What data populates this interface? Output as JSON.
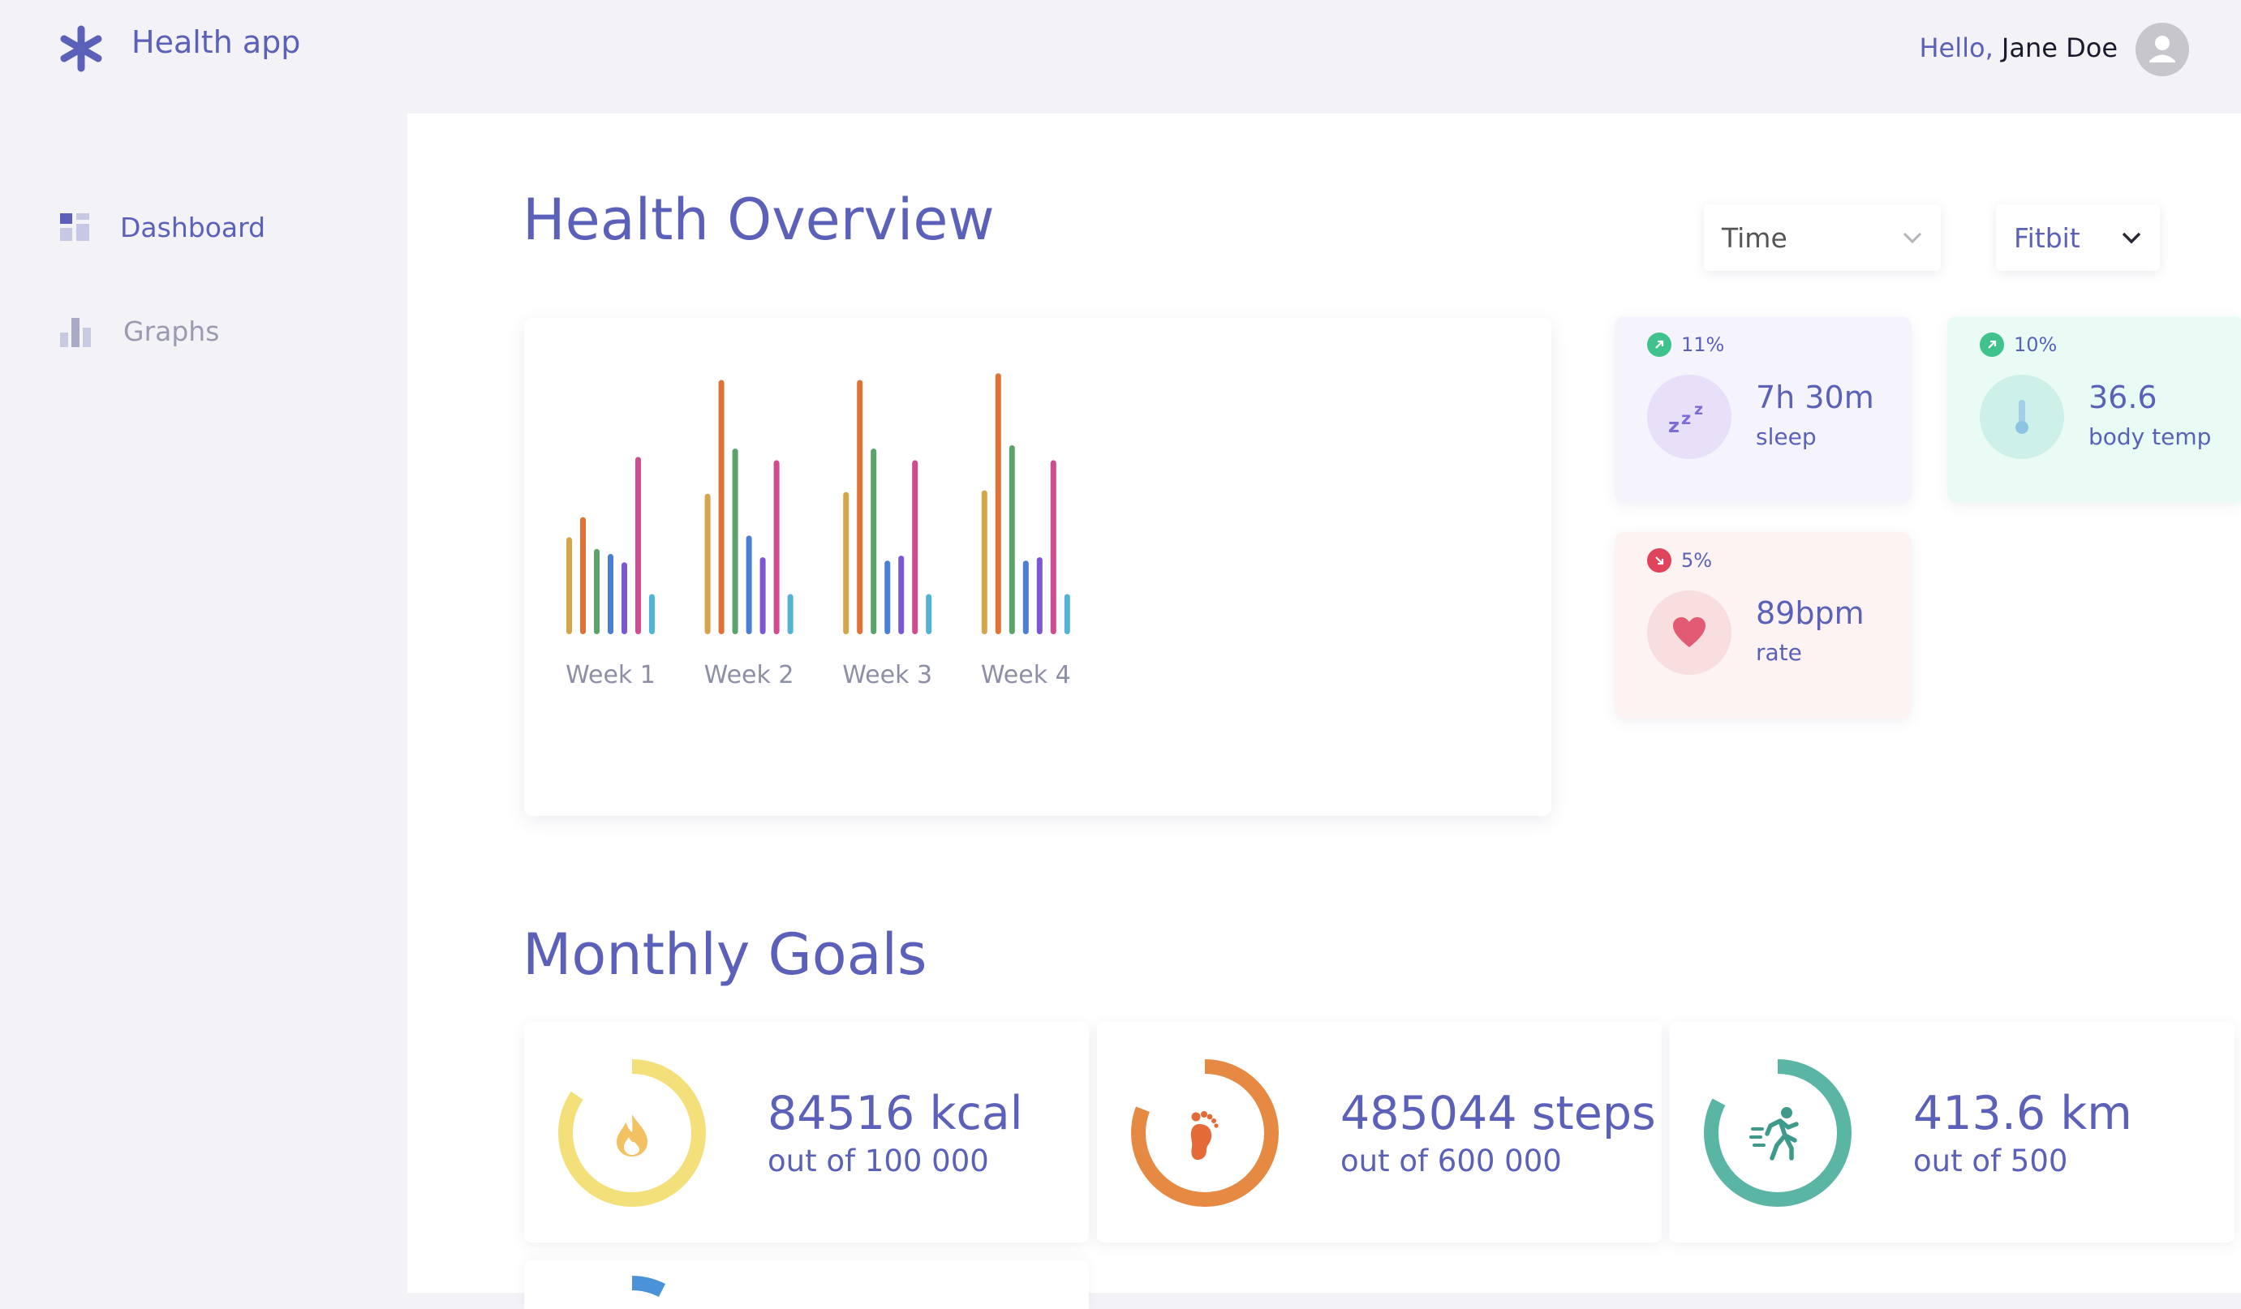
{
  "app": {
    "title": "Health app",
    "greeting_prefix": "Hello,",
    "user_name": "Jane Doe"
  },
  "sidebar": {
    "items": [
      {
        "label": "Dashboard",
        "icon": "dashboard-icon",
        "active": true
      },
      {
        "label": "Graphs",
        "icon": "bar-chart-icon",
        "active": false
      }
    ]
  },
  "overview": {
    "title": "Health Overview",
    "filters": {
      "time": "Time",
      "device": "Fitbit"
    }
  },
  "chart_data": {
    "type": "bar",
    "categories": [
      "Week 1",
      "Week 2",
      "Week 3",
      "Week 4"
    ],
    "series": [
      {
        "values": [
          58,
          84,
          85,
          86
        ],
        "color": "#d4a54a"
      },
      {
        "values": [
          70,
          152,
          152,
          156
        ],
        "color": "#e07238"
      },
      {
        "values": [
          51,
          111,
          111,
          113
        ],
        "color": "#5ca36b"
      },
      {
        "values": [
          48,
          59,
          44,
          44
        ],
        "color": "#4b7fd6"
      },
      {
        "values": [
          43,
          46,
          47,
          46
        ],
        "color": "#7d56d1"
      },
      {
        "values": [
          106,
          104,
          104,
          104
        ],
        "color": "#d04c8f"
      },
      {
        "values": [
          24,
          24,
          24,
          24
        ],
        "color": "#53b3d6"
      }
    ],
    "ylim": [
      0,
      160
    ]
  },
  "metrics": [
    {
      "trend": "11%",
      "direction": "up",
      "value": "7h 30m",
      "label": "sleep",
      "icon": "sleep-icon",
      "bg": "#f5f4fd",
      "circle": "#e8e0f8",
      "trend_color": "#3fc28c"
    },
    {
      "trend": "10%",
      "direction": "up",
      "value": "36.6",
      "label": "body temp",
      "icon": "thermometer-icon",
      "bg": "#eafbf6",
      "circle": "#cdf1e8",
      "trend_color": "#3fc28c"
    },
    {
      "trend": "5%",
      "direction": "down",
      "value": "89bpm",
      "label": "rate",
      "icon": "heart-icon",
      "bg": "#fdf3f3",
      "circle": "#f8dedf",
      "trend_color": "#e0445c"
    }
  ],
  "goals": {
    "title": "Monthly Goals",
    "items": [
      {
        "value": "84516 kcal",
        "target": "out of 100 000",
        "progress": 0.845,
        "color": "#f3e07a",
        "icon": "flame-icon"
      },
      {
        "value": "485044 steps",
        "target": "out of 600 000",
        "progress": 0.808,
        "color": "#e68942",
        "icon": "footprint-icon"
      },
      {
        "value": "413.6 km",
        "target": "out of 500",
        "progress": 0.827,
        "color": "#5ab5a5",
        "icon": "running-icon"
      }
    ]
  }
}
